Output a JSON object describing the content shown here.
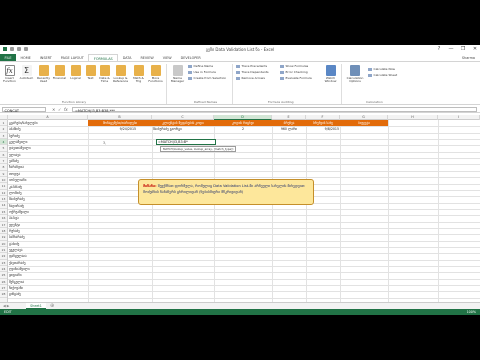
{
  "window": {
    "title": "გეზი  Data Validation List ნა - Excel",
    "controls": [
      "?",
      "—",
      "❐",
      "✕"
    ]
  },
  "tabs": [
    "FILE",
    "HOME",
    "INSERT",
    "PAGE LAYOUT",
    "FORMULAS",
    "DATA",
    "REVIEW",
    "VIEW",
    "DEVELOPER"
  ],
  "active_tab": "FORMULAS",
  "user": "Sharma",
  "ribbon": {
    "insert_function": "Insert Function",
    "autosum": "AutoSum",
    "recently_used": "Recently Used",
    "financial": "Financial",
    "logical": "Logical",
    "text": "Text",
    "date_time": "Date & Time",
    "lookup_reference": "Lookup & Reference",
    "math_trig": "Math & Trig",
    "more_functions": "More Functions",
    "function_library": "Function Library",
    "name_manager": "Name Manager",
    "define_name": "Define Name",
    "use_in_formula": "Use in Formula",
    "create_from_selection": "Create from Selection",
    "defined_names": "Defined Names",
    "trace_precedents": "Trace Precedents",
    "trace_dependents": "Trace Dependents",
    "remove_arrows": "Remove Arrows",
    "show_formulas": "Show Formulas",
    "error_checking": "Error Checking",
    "evaluate_formula": "Evaluate Formula",
    "formula_auditing": "Formula Auditing",
    "watch_window": "Watch Window",
    "calculation_options": "Calculation Options",
    "calculate_now": "Calculate Now",
    "calculate_sheet": "Calculate Sheet",
    "calculation": "Calculation"
  },
  "formula_bar": {
    "name_box": "CONCAT",
    "cancel": "✕",
    "enter": "✓",
    "fx": "fx",
    "content": "=MATCH(I3,B3:B38,***"
  },
  "columns": [
    "A",
    "B",
    "C",
    "D",
    "E",
    "F",
    "G",
    "H",
    "I"
  ],
  "selected_column": "D",
  "rows": [
    "1",
    "2",
    "3",
    "4",
    "5",
    "6",
    "7",
    "8",
    "9",
    "10",
    "11",
    "12",
    "13",
    "14",
    "15",
    "16",
    "17",
    "18",
    "19",
    "20",
    "21",
    "22",
    "23",
    "24",
    "25",
    "26",
    "27",
    "28"
  ],
  "selected_row": "4",
  "col_a": [
    "გვარები/სახელები",
    "აბაშიძე",
    "ბერიძე",
    "გელაშვილი",
    "დავითაშვილი",
    "ელიავა",
    "ვაშაძე",
    "ზარანდია",
    "თოდუა",
    "იოსელიანი",
    "კაპანაძე",
    "ლომიძე",
    "მაისურაძე",
    "ნადირაძე",
    "ოქრუაშვილი",
    "პაპავა",
    "ჟღენტი",
    "რუხაძე",
    "სამხარაძე",
    "ტაბიძე",
    "უგულავა",
    "ფანცულაია",
    "ქავთარაძე",
    "ღვინიაშვილი",
    "ყიფიანი",
    "შენგელია",
    "ჩიქოვანი",
    "ცინცაძე"
  ],
  "header_row": [
    "მონაცემები/თარიღები",
    "კლიენტის შეფასების კოდი",
    "კოდის რიცხვი",
    "ბრუნვა",
    "ბრუნვის სახე",
    "ბიუჯეტი"
  ],
  "row2": [
    "9/24/2015",
    "მაისურაძე გიორგი",
    "2",
    "960 ლარი",
    "9/8/2015"
  ],
  "active_cell": {
    "value": "=MATCH(I3,B3:B*",
    "label": "3,"
  },
  "tooltip": "MATCH(lookup_value, lookup_array, [match_type])",
  "callout": {
    "lead": "მიზანი:",
    "text": "შევქმნათ ფორმულა, რომელიც Data Validation List-ში არჩეული სახელის მიხედვით მოძებნის ჩანაწერს ცხრილიდან (ნებისმიერი მწკრივიდან)"
  },
  "sheet_nav": "◀ ▶",
  "sheet_tab": "Sheet1",
  "add_sheet": "⊕",
  "status": {
    "mode": "EDIT",
    "zoom": "100%"
  }
}
